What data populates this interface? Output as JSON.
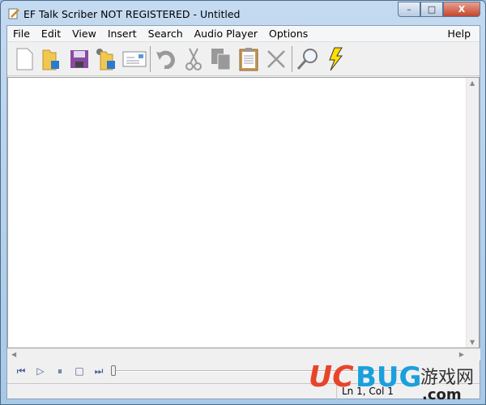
{
  "window": {
    "title": "EF Talk Scriber NOT REGISTERED - Untitled",
    "min": "–",
    "max": "□",
    "close": "X"
  },
  "menu": [
    "File",
    "Edit",
    "View",
    "Insert",
    "Search",
    "Audio Player",
    "Options",
    "Help"
  ],
  "toolbar": [
    {
      "icon": "new-file-icon"
    },
    {
      "icon": "open-folder-icon"
    },
    {
      "icon": "save-icon"
    },
    {
      "icon": "open-audio-icon"
    },
    {
      "icon": "email-icon"
    },
    {
      "icon": "undo-icon"
    },
    {
      "icon": "cut-icon"
    },
    {
      "icon": "copy-icon"
    },
    {
      "icon": "paste-icon"
    },
    {
      "icon": "delete-icon"
    },
    {
      "icon": "find-icon"
    },
    {
      "icon": "lightning-icon"
    }
  ],
  "player": {
    "buttons": [
      "⏮",
      "▷",
      "⏸",
      "□",
      "⏭"
    ],
    "position": 0
  },
  "status": {
    "position": "Ln 1, Col 1"
  },
  "watermark": {
    "text": "UCBUG游戏网 .com",
    "uc_color": "#e8442a",
    "bug_color": "#1aa0dc"
  }
}
